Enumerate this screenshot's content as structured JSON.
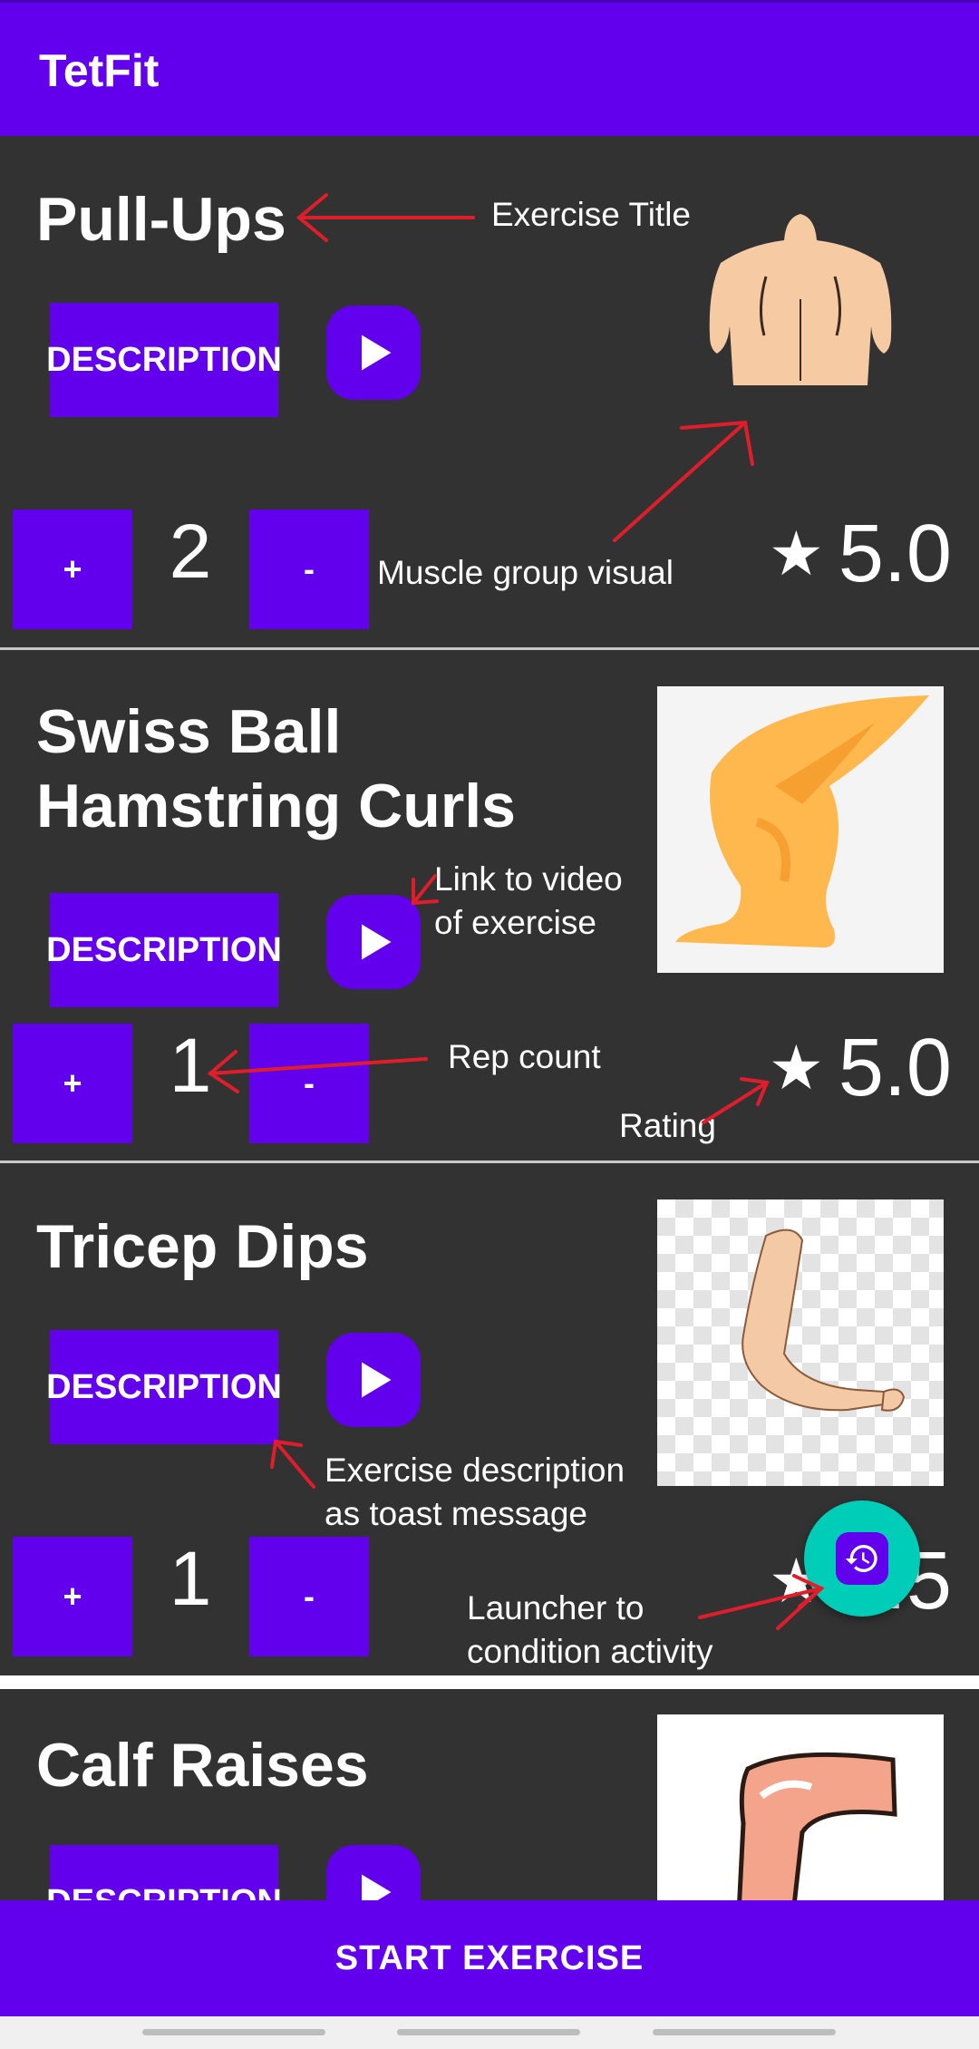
{
  "app": {
    "title": "TetFit"
  },
  "colors": {
    "primary": "#6200EE",
    "background": "#323232",
    "fab": "#00CDB8",
    "annotation_arrow": "#e01e2b"
  },
  "exercises": [
    {
      "title": "Pull-Ups",
      "description_label": "DESCRIPTION",
      "plus": "+",
      "minus": "-",
      "reps": "2",
      "rating": "5.0",
      "star": "★",
      "image": "back-muscles-illustration"
    },
    {
      "title": "Swiss Ball Hamstring Curls",
      "description_label": "DESCRIPTION",
      "plus": "+",
      "minus": "-",
      "reps": "1",
      "rating": "5.0",
      "star": "★",
      "image": "leg-muscles-illustration"
    },
    {
      "title": "Tricep Dips",
      "description_label": "DESCRIPTION",
      "plus": "+",
      "minus": "-",
      "reps": "1",
      "rating": "4.5",
      "star": "★",
      "image": "arm-illustration"
    },
    {
      "title": "Calf Raises",
      "description_label": "DESCRIPTION",
      "image": "knee-illustration"
    }
  ],
  "annotations": {
    "exercise_title": "Exercise Title",
    "muscle_group": "Muscle group visual",
    "video_link_1": "Link to video",
    "video_link_2": "of exercise",
    "rep_count": "Rep count",
    "rating": "Rating",
    "description_toast_1": "Exercise description",
    "description_toast_2": "as toast message",
    "launcher_1": "Launcher to",
    "launcher_2": "condition activity"
  },
  "icons": {
    "play": "play-icon",
    "fab": "history-icon",
    "star": "star-icon"
  },
  "footer": {
    "start_label": "START EXERCISE"
  }
}
